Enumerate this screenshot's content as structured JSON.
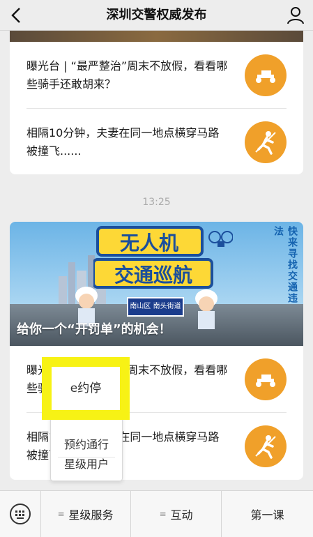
{
  "header": {
    "title": "深圳交警权威发布",
    "back_icon": "chevron-left-icon",
    "user_icon": "user-icon"
  },
  "card1": {
    "items": [
      {
        "text": "曝光台 | “最严整治”周末不放假，看看哪些骑手还敢胡来？",
        "icon": "scooter-icon"
      },
      {
        "text": "相隔10分钟，夫妻在同一地点横穿马路被撞飞......",
        "icon": "pedestrian-icon"
      }
    ]
  },
  "timestamp": "13:25",
  "card2": {
    "banner": {
      "headline": "无人机交通巡航",
      "side_text": "快来寻找交通违法",
      "sign": "南山区 南头街道",
      "caption": "给你一个“开罚单”的机会！"
    },
    "items": [
      {
        "text": "曝光台 | “最严整治”周末不放假，看看哪些骑手还敢胡来？",
        "icon": "scooter-icon"
      },
      {
        "text": "相隔10分钟，夫妻在同一地点横穿马路被撞飞......",
        "icon": "pedestrian-icon"
      }
    ]
  },
  "popup_menu": {
    "items": [
      "e约停",
      "预约通行",
      "星级用户"
    ],
    "highlight_color": "#f7f215"
  },
  "bottom_menu": {
    "keyboard_icon": "keyboard-icon",
    "tabs": [
      "星级服务",
      "互动",
      "第一课"
    ]
  },
  "colors": {
    "accent": "#f0a02a",
    "background": "#ededed"
  }
}
